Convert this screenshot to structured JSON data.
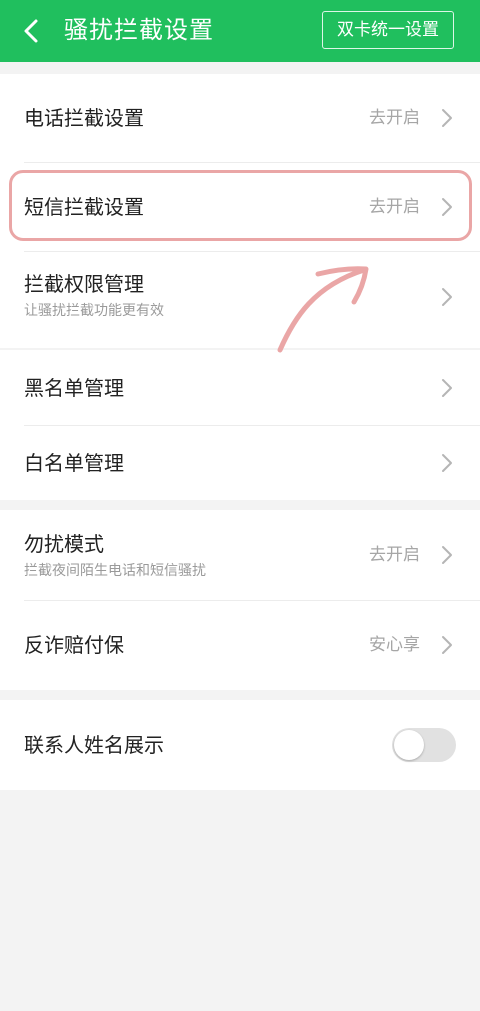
{
  "header": {
    "title": "骚扰拦截设置",
    "dual_sim_label": "双卡统一设置",
    "bg_color": "#20bf5e"
  },
  "settings": {
    "call_block": {
      "title": "电话拦截设置",
      "value": "去开启"
    },
    "sms_block": {
      "title": "短信拦截设置",
      "value": "去开启"
    },
    "permissions": {
      "title": "拦截权限管理",
      "subtitle": "让骚扰拦截功能更有效"
    },
    "blacklist": {
      "title": "黑名单管理"
    },
    "whitelist": {
      "title": "白名单管理"
    },
    "dnd": {
      "title": "勿扰模式",
      "subtitle": "拦截夜间陌生电话和短信骚扰",
      "value": "去开启"
    },
    "fraud_compensation": {
      "title": "反诈赔付保",
      "value": "安心享"
    },
    "contact_name_display": {
      "title": "联系人姓名展示",
      "enabled": false
    }
  },
  "annotation": {
    "highlight_color": "#eaa6a6",
    "icon": "arrow-up-right-icon"
  }
}
